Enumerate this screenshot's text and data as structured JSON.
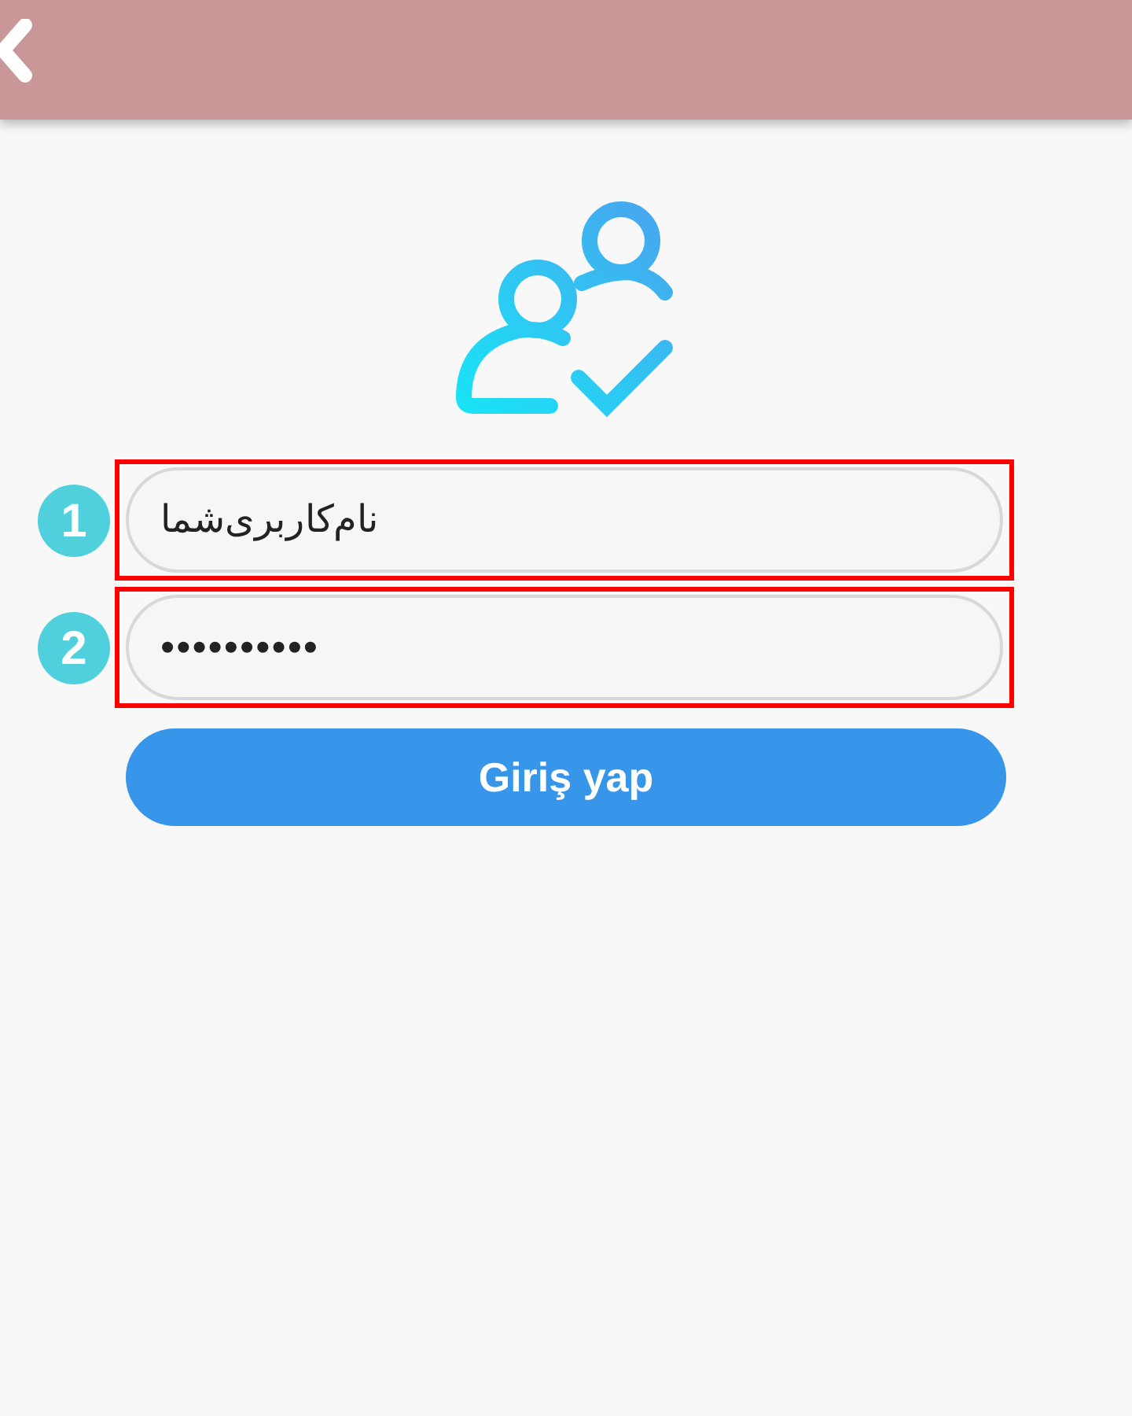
{
  "fields": [
    {
      "marker": "1",
      "value": "نام‌کاربری‌شما",
      "kind": "text"
    },
    {
      "marker": "2",
      "value": "••••••••••",
      "kind": "password"
    }
  ],
  "login_button": "Giriş yap"
}
